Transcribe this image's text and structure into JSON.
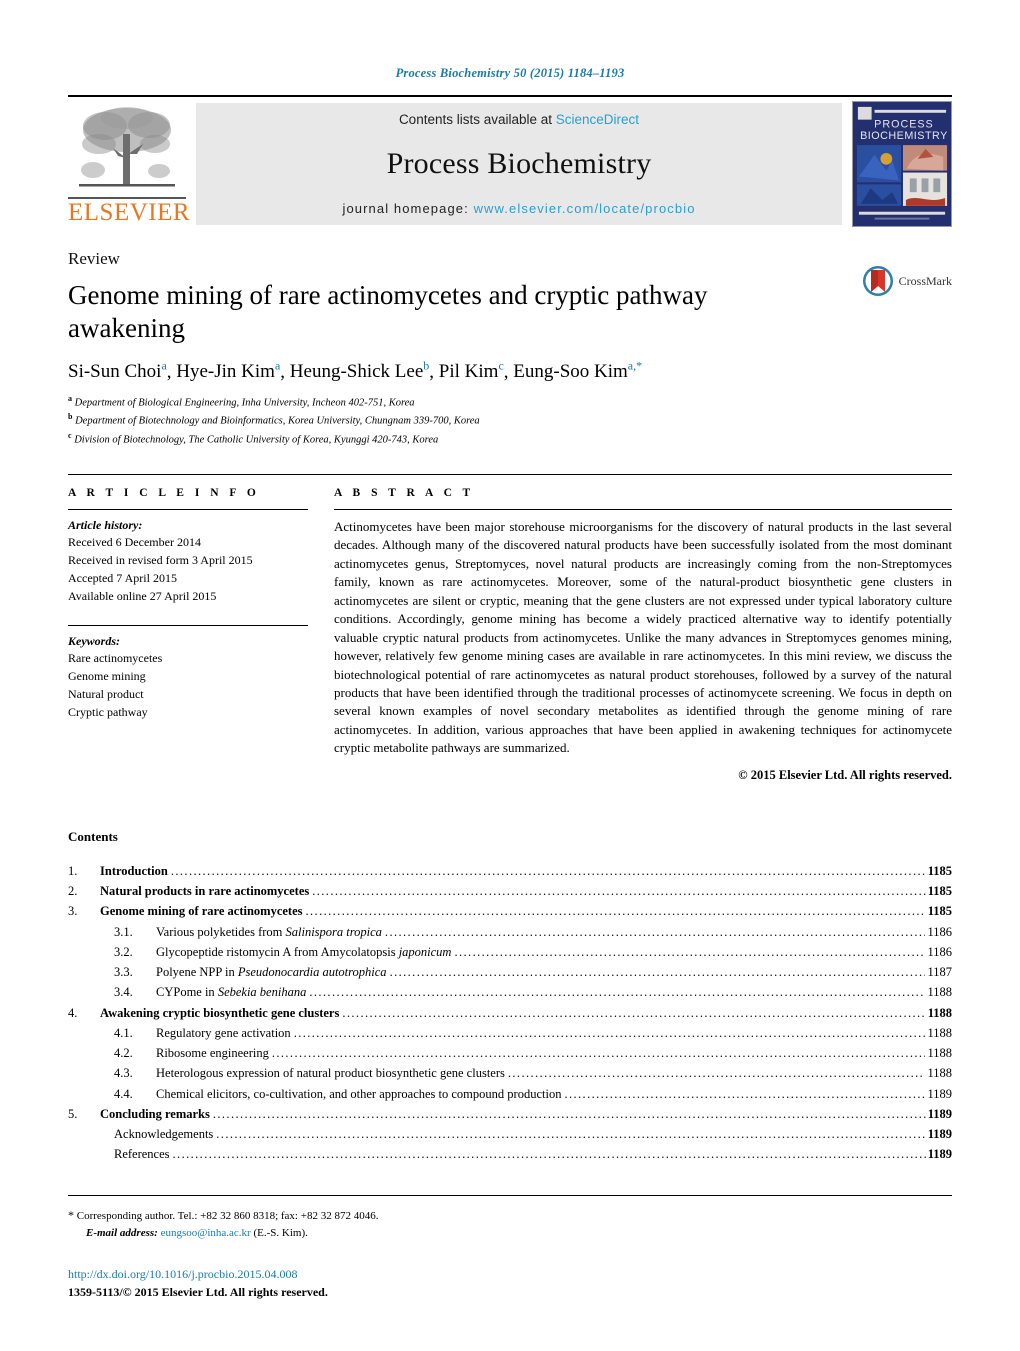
{
  "running_head": "Process Biochemistry 50 (2015) 1184–1193",
  "masthead": {
    "publisher": "ELSEVIER",
    "contents_prefix": "Contents lists available at ",
    "contents_link": "ScienceDirect",
    "journal_title": "Process Biochemistry",
    "homepage_prefix": "journal homepage: ",
    "homepage_url": "www.elsevier.com/locate/procbio",
    "cover_title_line1": "PROCESS",
    "cover_title_line2": "BIOCHEMISTRY",
    "link_color": "#2a9fd0",
    "brand_orange": "#E87722"
  },
  "article": {
    "type_label": "Review",
    "title": "Genome mining of rare actinomycetes and cryptic pathway awakening",
    "crossmark_label": "CrossMark",
    "authors": [
      {
        "name": "Si-Sun Choi",
        "sup": "a"
      },
      {
        "name": "Hye-Jin Kim",
        "sup": "a"
      },
      {
        "name": "Heung-Shick Lee",
        "sup": "b"
      },
      {
        "name": "Pil Kim",
        "sup": "c"
      },
      {
        "name": "Eung-Soo Kim",
        "sup": "a,*"
      }
    ],
    "affiliations": [
      {
        "mark": "a",
        "text": "Department of Biological Engineering, Inha University, Incheon 402-751, Korea"
      },
      {
        "mark": "b",
        "text": "Department of Biotechnology and Bioinformatics, Korea University, Chungnam 339-700, Korea"
      },
      {
        "mark": "c",
        "text": "Division of Biotechnology, The Catholic University of Korea, Kyunggi 420-743, Korea"
      }
    ]
  },
  "article_info": {
    "heading": "A R T I C L E   I N F O",
    "history_label": "Article history:",
    "history": [
      "Received 6 December 2014",
      "Received in revised form 3 April 2015",
      "Accepted 7 April 2015",
      "Available online 27 April 2015"
    ],
    "keywords_label": "Keywords:",
    "keywords": [
      "Rare actinomycetes",
      "Genome mining",
      "Natural product",
      "Cryptic pathway"
    ]
  },
  "abstract": {
    "heading": "A B S T R A C T",
    "paragraphs": [
      "Actinomycetes have been major storehouse microorganisms for the discovery of natural products in the last several decades. Although many of the discovered natural products have been successfully isolated from the most dominant actinomycetes genus, Streptomyces, novel natural products are increasingly coming from the non-Streptomyces family, known as rare actinomycetes. Moreover, some of the natural-product biosynthetic gene clusters in actinomycetes are silent or cryptic, meaning that the gene clusters are not expressed under typical laboratory culture conditions. Accordingly, genome mining has become a widely practiced alternative way to identify potentially valuable cryptic natural products from actinomycetes. Unlike the many advances in Streptomyces genomes mining, however, relatively few genome mining cases are available in rare actinomycetes. In this mini review, we discuss the biotechnological potential of rare actinomycetes as natural product storehouses, followed by a survey of the natural products that have been identified through the traditional processes of actinomycete screening. We focus in depth on several known examples of novel secondary metabolites as identified through the genome mining of rare actinomycetes. In addition, various approaches that have been applied in awakening techniques for actinomycete cryptic metabolite pathways are summarized."
    ],
    "copyright": "© 2015 Elsevier Ltd. All rights reserved."
  },
  "contents": {
    "heading": "Contents",
    "entries": [
      {
        "level": 1,
        "num": "1.",
        "label": "Introduction",
        "page": "1185"
      },
      {
        "level": 1,
        "num": "2.",
        "label": "Natural products in rare actinomycetes",
        "page": "1185"
      },
      {
        "level": 1,
        "num": "3.",
        "label": "Genome mining of rare actinomycetes",
        "page": "1185"
      },
      {
        "level": 2,
        "num": "3.1.",
        "label": "Various polyketides from ",
        "italic": "Salinispora tropica",
        "page": "1186"
      },
      {
        "level": 2,
        "num": "3.2.",
        "label": "Glycopeptide ristomycin A from Amycolatopsis ",
        "italic": "japonicum",
        "page": "1186"
      },
      {
        "level": 2,
        "num": "3.3.",
        "label": "Polyene NPP in ",
        "italic": "Pseudonocardia autotrophica",
        "page": "1187"
      },
      {
        "level": 2,
        "num": "3.4.",
        "label": "CYPome in ",
        "italic": "Sebekia benihana",
        "page": "1188"
      },
      {
        "level": 1,
        "num": "4.",
        "label": "Awakening cryptic biosynthetic gene clusters",
        "page": "1188"
      },
      {
        "level": 2,
        "num": "4.1.",
        "label": "Regulatory gene activation",
        "page": "1188"
      },
      {
        "level": 2,
        "num": "4.2.",
        "label": "Ribosome engineering",
        "page": "1188"
      },
      {
        "level": 2,
        "num": "4.3.",
        "label": "Heterologous expression of natural product biosynthetic gene clusters",
        "page": "1188"
      },
      {
        "level": 2,
        "num": "4.4.",
        "label": "Chemical elicitors, co-cultivation, and other approaches to compound production",
        "page": "1189"
      },
      {
        "level": 1,
        "num": "5.",
        "label": "Concluding remarks",
        "page": "1189"
      },
      {
        "level": 0,
        "num": "",
        "label": "Acknowledgements",
        "page": "1189"
      },
      {
        "level": 0,
        "num": "",
        "label": "References",
        "page": "1189"
      }
    ]
  },
  "footer": {
    "corresponding_star": "*",
    "corresponding_text": "Corresponding author. Tel.: +82 32 860 8318; fax: +82 32 872 4046.",
    "email_label": "E-mail address:",
    "email": "eungsoo@inha.ac.kr",
    "email_suffix": "(E.-S. Kim).",
    "doi": "http://dx.doi.org/10.1016/j.procbio.2015.04.008",
    "issn_line": "1359-5113/© 2015 Elsevier Ltd. All rights reserved."
  }
}
